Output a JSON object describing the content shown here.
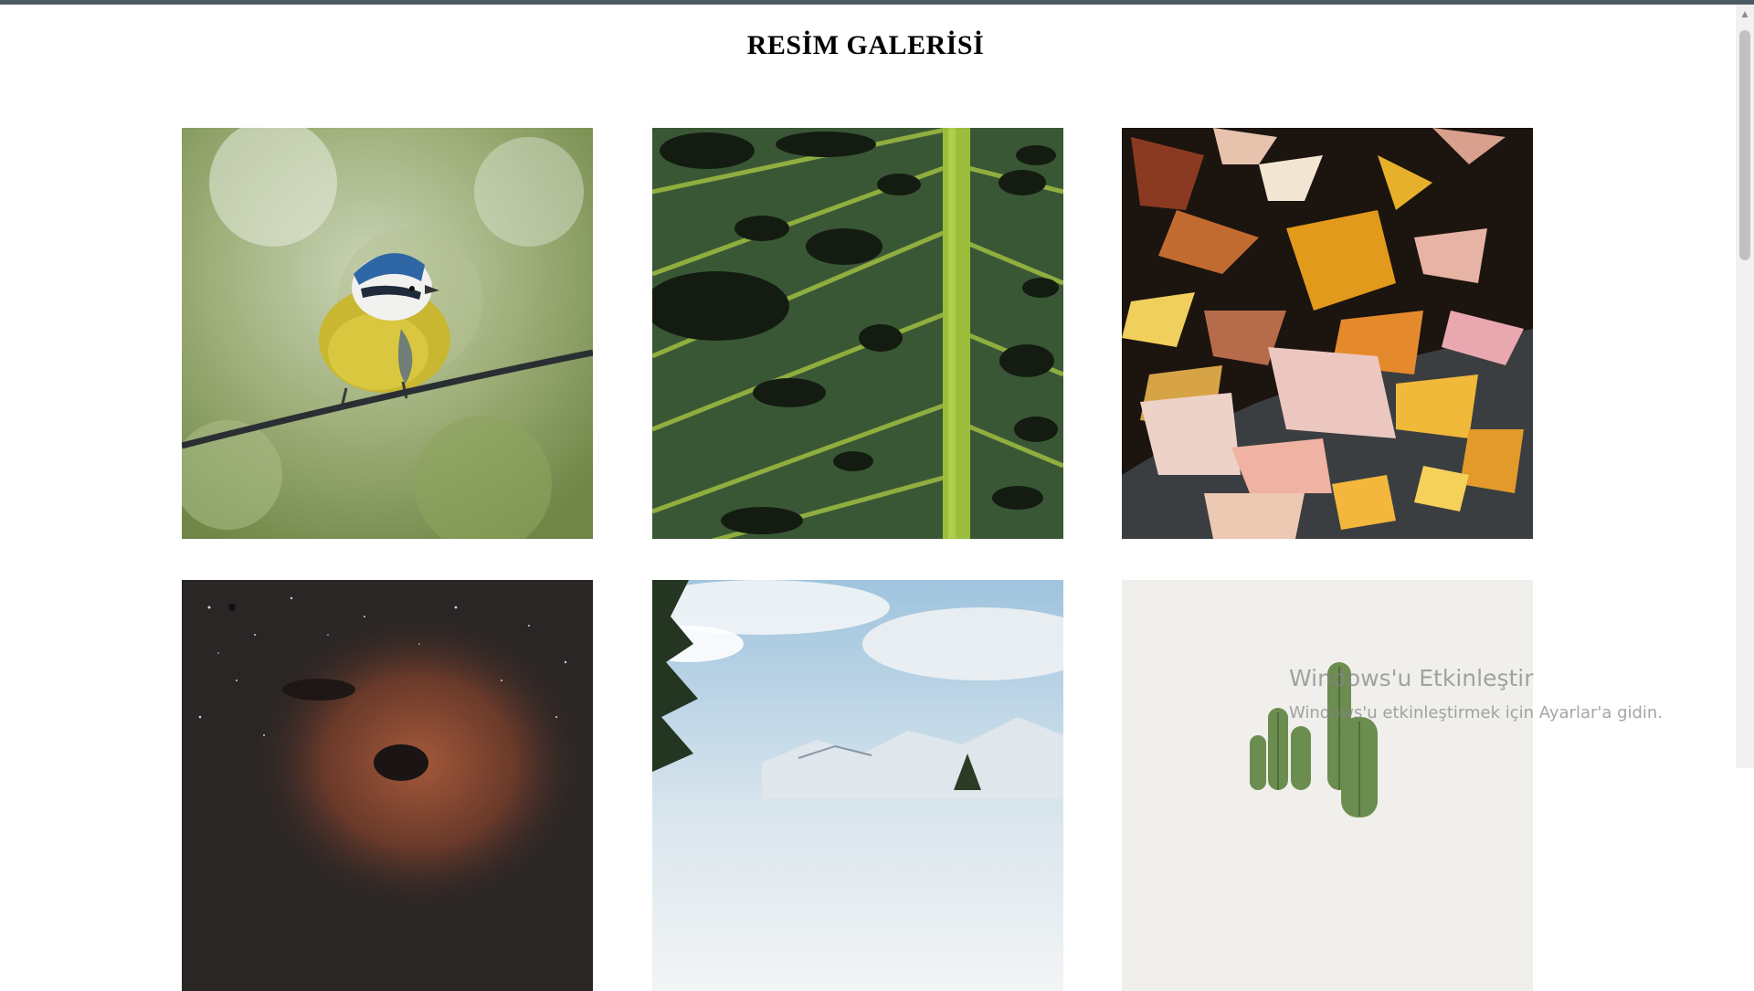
{
  "page": {
    "title": "RESİM GALERİSİ"
  },
  "gallery": {
    "images": [
      {
        "subject": "blue tit bird perched on a wire"
      },
      {
        "subject": "green monstera leaf close-up"
      },
      {
        "subject": "autumn leaves floating on water"
      },
      {
        "subject": "starry night sky nebula"
      },
      {
        "subject": "snowy mountain landscape with pine trees"
      },
      {
        "subject": "cactus against white background"
      }
    ]
  },
  "watermark": {
    "title": "Windows'u Etkinleştir",
    "subtitle": "Windows'u etkinleştirmek için Ayarlar'a gidin."
  },
  "colors": {
    "background": "#ffffff",
    "top_strip": "#4b5a63",
    "scrollbar_track": "#f1f1f1",
    "scrollbar_thumb": "#c1c1c1"
  }
}
